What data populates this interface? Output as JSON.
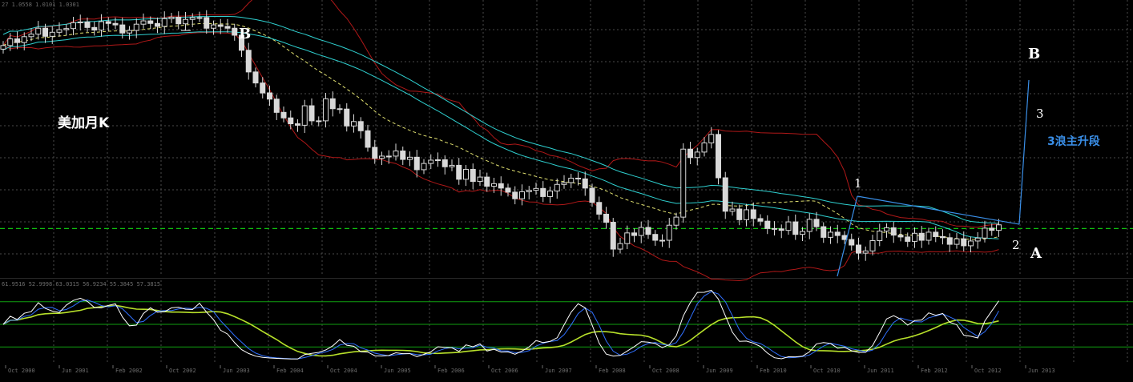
{
  "header": {
    "main_values": "27 1.0558 1.0101 1.0301",
    "indicator_values": "61.9516 52.9998 63.0315 56.9234 55.3845 57.3815"
  },
  "annotations": {
    "title": "美加月K",
    "label_b_left": "B",
    "label_b_right": "B",
    "label_a": "A",
    "label_1": "1",
    "label_2": "2",
    "label_3": "3",
    "wave_label": "3浪主升段"
  },
  "colors": {
    "background": "#000000",
    "grid": "#4a4a4a",
    "candle": "#d9d9d9",
    "bollinger": "#b01818",
    "ma_cyan": "#2fd0d0",
    "ma_dash": "#e0e070",
    "green_level": "#10c010",
    "trendline": "#3a8fe8",
    "stoch_main": "#ffffff",
    "stoch_signal": "#3070ff",
    "stoch_slow": "#b7e02a",
    "stoch_level": "#10a010"
  },
  "x_axis": {
    "labels": [
      "Oct 2000",
      "Jun 2001",
      "Feb 2002",
      "Oct 2002",
      "Jun 2003",
      "Feb 2004",
      "Oct 2004",
      "Jun 2005",
      "Feb 2006",
      "Oct 2006",
      "Jun 2007",
      "Feb 2008",
      "Oct 2008",
      "Jun 2009",
      "Feb 2010",
      "Oct 2010",
      "Jun 2011",
      "Feb 2012",
      "Oct 2012",
      "Jun 2013"
    ]
  },
  "chart_data": {
    "type": "candlestick",
    "title": "美加月K",
    "price_min": 0.9,
    "price_max": 1.63,
    "green_level_price": 1.03,
    "candles_approx_monthly_close": [
      1.528,
      1.546,
      1.536,
      1.552,
      1.559,
      1.575,
      1.553,
      1.564,
      1.571,
      1.574,
      1.59,
      1.592,
      1.577,
      1.57,
      1.593,
      1.588,
      1.584,
      1.562,
      1.569,
      1.586,
      1.595,
      1.588,
      1.58,
      1.601,
      1.605,
      1.587,
      1.599,
      1.604,
      1.604,
      1.575,
      1.584,
      1.58,
      1.575,
      1.556,
      1.515,
      1.456,
      1.426,
      1.399,
      1.382,
      1.346,
      1.331,
      1.315,
      1.311,
      1.364,
      1.323,
      1.323,
      1.383,
      1.356,
      1.355,
      1.309,
      1.321,
      1.296,
      1.251,
      1.221,
      1.227,
      1.227,
      1.241,
      1.218,
      1.224,
      1.19,
      1.207,
      1.216,
      1.217,
      1.198,
      1.202,
      1.164,
      1.191,
      1.158,
      1.17,
      1.145,
      1.152,
      1.14,
      1.129,
      1.111,
      1.13,
      1.134,
      1.139,
      1.117,
      1.132,
      1.15,
      1.155,
      1.167,
      1.165,
      1.14,
      1.101,
      1.069,
      1.047,
      0.974,
      0.989,
      1.018,
      1.011,
      1.033,
      1.014,
      0.998,
      0.998,
      1.039,
      1.061,
      1.246,
      1.223,
      1.238,
      1.263,
      1.286,
      1.168,
      1.077,
      1.083,
      1.054,
      1.081,
      1.057,
      1.05,
      1.03,
      1.029,
      1.025,
      1.048,
      1.014,
      1.022,
      1.055,
      1.035,
      1.006,
      1.02,
      1.011,
      1.0,
      0.985,
      0.963,
      0.969,
      0.997,
      1.023,
      1.032,
      1.012,
      1.007,
      0.995,
      1.017,
      0.998,
      1.02,
      1.008,
      1.005,
      0.987,
      1.002,
      0.983,
      0.996,
      1.004,
      1.031,
      1.025,
      1.04
    ],
    "stochastic": {
      "levels": [
        80,
        50,
        20
      ],
      "indicator_values": [
        61.9516,
        52.9998,
        63.0315,
        56.9234,
        55.3845,
        57.3815
      ]
    },
    "annotations": [
      "B",
      "B",
      "A",
      "1",
      "2",
      "3",
      "3浪主升段"
    ]
  }
}
